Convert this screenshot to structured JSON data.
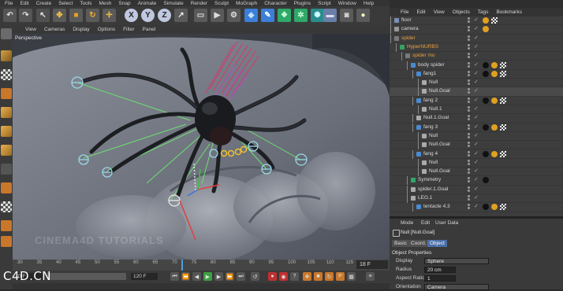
{
  "menubar": [
    "File",
    "Edit",
    "Create",
    "Select",
    "Tools",
    "Mesh",
    "Snap",
    "Animate",
    "Simulate",
    "Render",
    "Sculpt",
    "MoGraph",
    "Character",
    "Plugins",
    "Script",
    "Window",
    "Help"
  ],
  "toolbar": {
    "buttons": [
      {
        "name": "select-arrow-icon",
        "glyph": "↖",
        "bg": "#505050",
        "color": "#e8e8e8"
      },
      {
        "name": "move-icon",
        "glyph": "✥",
        "bg": "#5a5a5a",
        "color": "#f0c040"
      },
      {
        "name": "scale-icon",
        "glyph": "■",
        "bg": "#5a5a5a",
        "color": "#f0a020"
      },
      {
        "name": "rotate-icon",
        "glyph": "↻",
        "bg": "#5a5a5a",
        "color": "#f0b030"
      },
      {
        "name": "recent-tool-icon",
        "glyph": "✛",
        "bg": "#5a5a5a",
        "color": "#f0c040"
      },
      {
        "name": "x-axis-icon",
        "glyph": "X",
        "bg": "#c0c8e0",
        "color": "#222"
      },
      {
        "name": "y-axis-icon",
        "glyph": "Y",
        "bg": "#c0c8e0",
        "color": "#222"
      },
      {
        "name": "z-axis-icon",
        "glyph": "Z",
        "bg": "#c0c8e0",
        "color": "#222"
      },
      {
        "name": "coordinate-system-icon",
        "glyph": "↗",
        "bg": "#5a5a5a",
        "color": "#eee"
      },
      {
        "name": "render-region-icon",
        "glyph": "▭",
        "bg": "#5a5a5a",
        "color": "#ddd"
      },
      {
        "name": "render-view-icon",
        "glyph": "▶",
        "bg": "#5a5a5a",
        "color": "#ddd"
      },
      {
        "name": "render-settings-icon",
        "glyph": "⚙",
        "bg": "#5a5a5a",
        "color": "#ddd"
      },
      {
        "name": "cube-primitive-icon",
        "glyph": "◆",
        "bg": "#3b7fd9",
        "color": "#bfe0ff"
      },
      {
        "name": "spline-pen-icon",
        "glyph": "✎",
        "bg": "#3b7fd9",
        "color": "#fff"
      },
      {
        "name": "nurbs-icon",
        "glyph": "❖",
        "bg": "#2fa86a",
        "color": "#c8ffd8"
      },
      {
        "name": "array-icon",
        "glyph": "✲",
        "bg": "#2fa86a",
        "color": "#c8ffd8"
      },
      {
        "name": "deformer-icon",
        "glyph": "✺",
        "bg": "#2a8d8d",
        "color": "#cff"
      },
      {
        "name": "floor-icon",
        "glyph": "▬",
        "bg": "#6a7fa8",
        "color": "#dde"
      },
      {
        "name": "camera-icon",
        "glyph": "◙",
        "bg": "#5a5a5a",
        "color": "#ddd"
      },
      {
        "name": "light-icon",
        "glyph": "●",
        "bg": "#5a5a5a",
        "color": "#f5f0c0"
      }
    ]
  },
  "viewport_menu": [
    "View",
    "Cameras",
    "Display",
    "Options",
    "Filter",
    "Panel"
  ],
  "viewport_label": "Perspective",
  "watermark": "CINEMA4D TUTORIALS",
  "timeline": {
    "ticks": [
      "30",
      "35",
      "40",
      "45",
      "50",
      "55",
      "60",
      "65",
      "70",
      "75",
      "80",
      "85",
      "90",
      "95",
      "100",
      "105",
      "110",
      "115"
    ],
    "current_frame": "18 F"
  },
  "transport": {
    "start_field": "0 F",
    "end_field": "120 F"
  },
  "object_manager": {
    "menu": [
      "File",
      "Edit",
      "View",
      "Objects",
      "Tags",
      "Bookmarks"
    ],
    "rows": [
      {
        "indent": 0,
        "label": "floor",
        "color": "#d8d8d8",
        "icon": "#7a8fb8",
        "tags": [
          "#e0a020",
          "checker"
        ]
      },
      {
        "indent": 0,
        "label": "camera",
        "color": "#d8d8d8",
        "icon": "#999",
        "tags": [
          "#e0a020"
        ]
      },
      {
        "indent": 0,
        "label": "spider",
        "color": "#e8a040",
        "icon": "#7a7a7a",
        "tags": []
      },
      {
        "indent": 1,
        "label": "HyperNURBS",
        "color": "#e8a040",
        "icon": "#3aa060",
        "tags": []
      },
      {
        "indent": 2,
        "label": "spider mo",
        "color": "#e8a040",
        "icon": "#7a7a7a",
        "tags": []
      },
      {
        "indent": 3,
        "label": "body spider",
        "color": "#d8d8d8",
        "icon": "#4a8ad0",
        "tags": [
          "#111",
          "#e0a020",
          "checker"
        ]
      },
      {
        "indent": 4,
        "label": "fang1",
        "color": "#d8d8d8",
        "icon": "#4a8ad0",
        "tags": [
          "#111",
          "#e0a020",
          "checker"
        ]
      },
      {
        "indent": 5,
        "label": "Null",
        "color": "#d8d8d8",
        "icon": "#aaa",
        "tags": []
      },
      {
        "indent": 5,
        "label": "Null.Goal",
        "color": "#d8d8d8",
        "icon": "#aaa",
        "tags": []
      },
      {
        "indent": 4,
        "label": "fang 2",
        "color": "#d8d8d8",
        "icon": "#4a8ad0",
        "tags": [
          "#111",
          "#e0a020",
          "checker"
        ]
      },
      {
        "indent": 5,
        "label": "Null.1",
        "color": "#d8d8d8",
        "icon": "#aaa",
        "tags": []
      },
      {
        "indent": 4,
        "label": "Null.1.Goal",
        "color": "#d8d8d8",
        "icon": "#aaa",
        "tags": []
      },
      {
        "indent": 4,
        "label": "fang 3",
        "color": "#d8d8d8",
        "icon": "#4a8ad0",
        "tags": [
          "#111",
          "#e0a020",
          "checker"
        ]
      },
      {
        "indent": 5,
        "label": "Null",
        "color": "#d8d8d8",
        "icon": "#aaa",
        "tags": []
      },
      {
        "indent": 5,
        "label": "Null.Goal",
        "color": "#d8d8d8",
        "icon": "#aaa",
        "tags": []
      },
      {
        "indent": 4,
        "label": "fang 4",
        "color": "#d8d8d8",
        "icon": "#4a8ad0",
        "tags": [
          "#111",
          "#e0a020",
          "checker"
        ]
      },
      {
        "indent": 5,
        "label": "Null",
        "color": "#d8d8d8",
        "icon": "#aaa",
        "tags": []
      },
      {
        "indent": 5,
        "label": "Null.Goal",
        "color": "#d8d8d8",
        "icon": "#aaa",
        "tags": []
      },
      {
        "indent": 3,
        "label": "Symmetry",
        "color": "#d8d8d8",
        "icon": "#2fa86a",
        "tags": [
          "#111"
        ]
      },
      {
        "indent": 3,
        "label": "spider.1.Goal",
        "color": "#d8d8d8",
        "icon": "#aaa",
        "tags": []
      },
      {
        "indent": 3,
        "label": "LEG.1",
        "color": "#d8d8d8",
        "icon": "#aaa",
        "tags": []
      },
      {
        "indent": 4,
        "label": "tentacle 4.3",
        "color": "#d8d8d8",
        "icon": "#4a8ad0",
        "tags": [
          "#111",
          "#e0a020",
          "checker"
        ]
      }
    ]
  },
  "attributes": {
    "menu": [
      "Mode",
      "Edit",
      "User Data"
    ],
    "object_title": "Null [Null.Goal]",
    "tabs": [
      "Basic",
      "Coord.",
      "Object"
    ],
    "active_tab": "Object",
    "section": "Object Properties",
    "fields": [
      {
        "label": "Display",
        "value": "Sphere",
        "kind": "select"
      },
      {
        "label": "Radius",
        "value": "20 cm",
        "kind": "number"
      },
      {
        "label": "Aspect Ratio",
        "value": "1",
        "kind": "number"
      },
      {
        "label": "Orientation",
        "value": "Camera",
        "kind": "select"
      }
    ]
  },
  "corner_watermark": "C4D.CN"
}
